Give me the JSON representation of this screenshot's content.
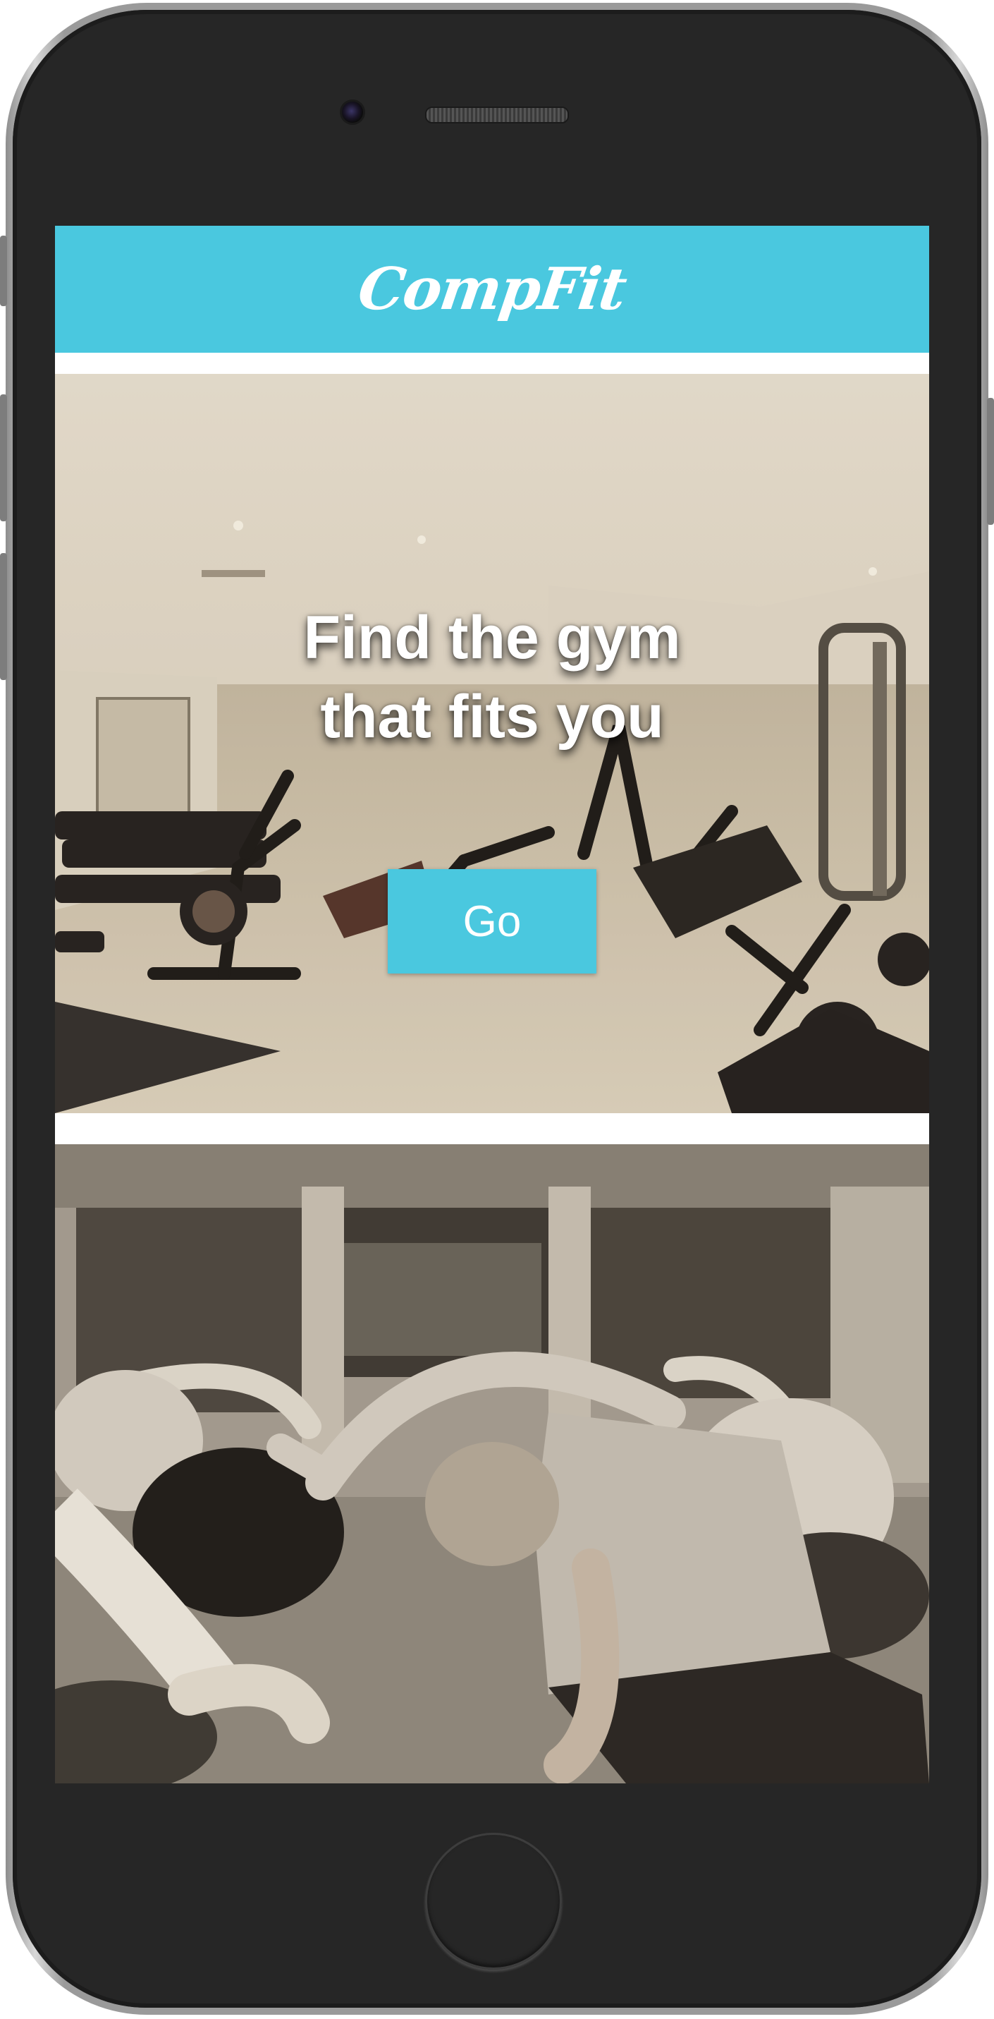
{
  "app": {
    "logo_text": "CompFit",
    "brand_color": "#4ac8df"
  },
  "hero": {
    "title": "Find the gym that fits you",
    "cta_label": "Go",
    "image": "gym-interior-photo"
  },
  "secondary": {
    "image": "yoga-class-photo"
  },
  "device": {
    "frame": "smartphone",
    "home_button_icon": "home-button-ring"
  }
}
